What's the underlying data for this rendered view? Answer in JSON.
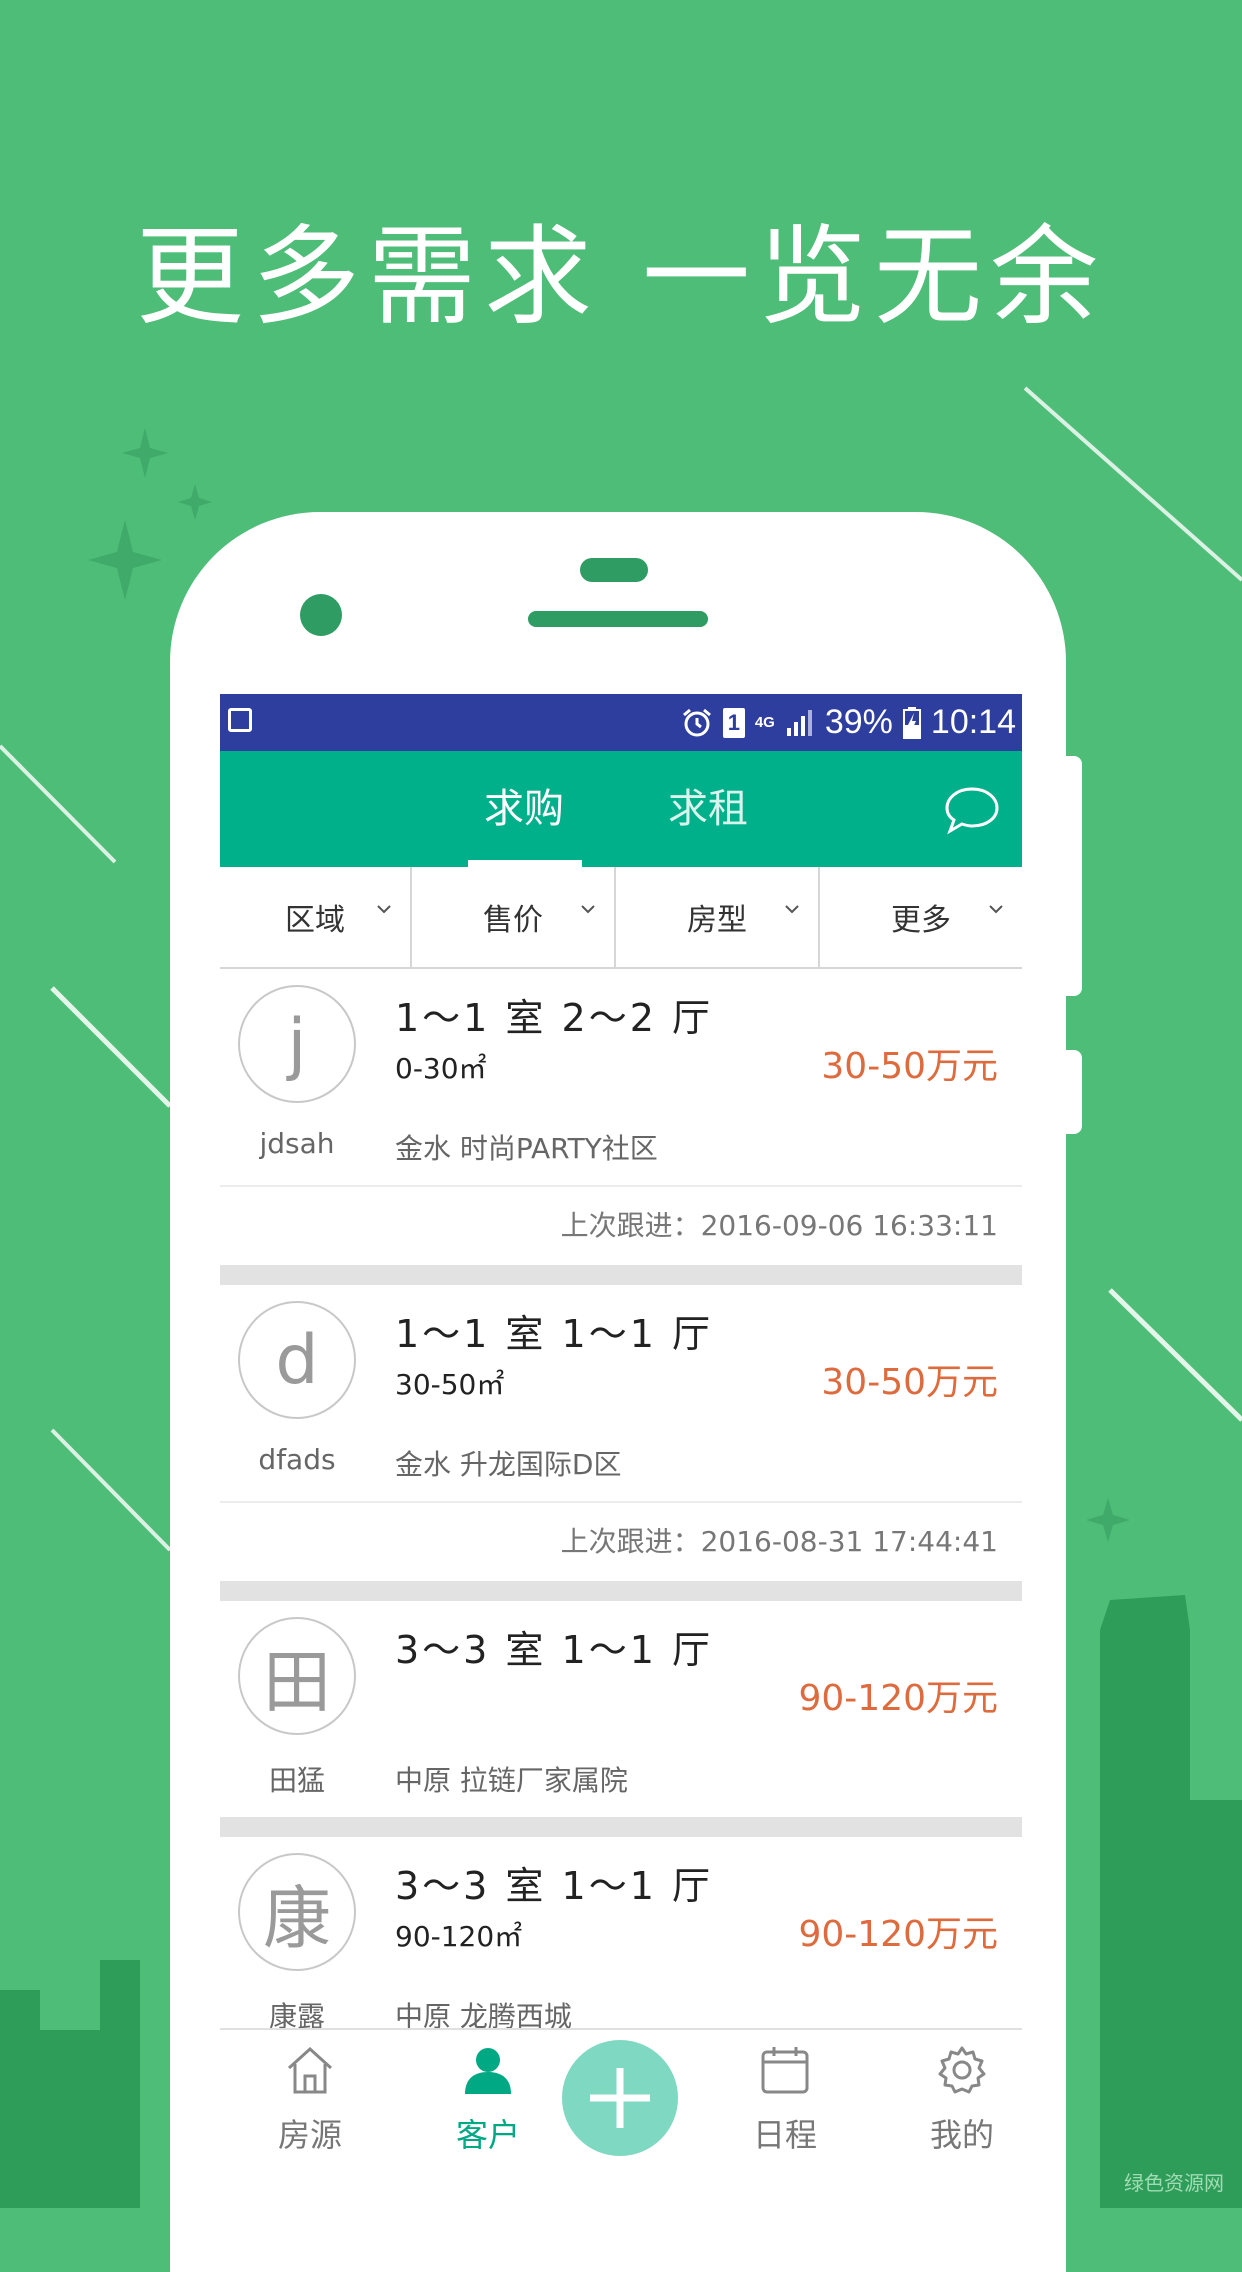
{
  "promo": {
    "title": "更多需求 一览无余"
  },
  "colors": {
    "background": "#4dbd78",
    "statusbar": "#2d3e9e",
    "appbar": "#00b08b",
    "price": "#dd6b3d",
    "accent": "#00a884"
  },
  "statusbar": {
    "sim": "1",
    "network": "4G",
    "battery": "39%",
    "time": "10:14",
    "icons": [
      "image-icon",
      "alarm-icon",
      "sim-icon",
      "network-icon",
      "signal-icon",
      "battery-icon"
    ]
  },
  "appbar": {
    "tabs": [
      {
        "label": "求购",
        "active": true
      },
      {
        "label": "求租",
        "active": false
      }
    ],
    "chat_icon": "chat-bubble-icon"
  },
  "filters": [
    {
      "label": "区域"
    },
    {
      "label": "售价"
    },
    {
      "label": "房型"
    },
    {
      "label": "更多"
    }
  ],
  "listings": [
    {
      "avatar": "j",
      "name": "jdsah",
      "room": "1～1 室 2～2 厅",
      "area": "0-30㎡",
      "price": "30-50万元",
      "district": "金水 时尚PARTY社区",
      "last_follow": "上次跟进：2016-09-06 16:33:11"
    },
    {
      "avatar": "d",
      "name": "dfads",
      "room": "1～1 室 1～1 厅",
      "area": "30-50㎡",
      "price": "30-50万元",
      "district": "金水 升龙国际D区",
      "last_follow": "上次跟进：2016-08-31 17:44:41"
    },
    {
      "avatar": "田",
      "name": "田猛",
      "room": "3～3 室 1～1 厅",
      "area": "",
      "price": "90-120万元",
      "district": "中原 拉链厂家属院",
      "last_follow": ""
    },
    {
      "avatar": "康",
      "name": "康露",
      "room": "3～3 室 1～1 厅",
      "area": "90-120㎡",
      "price": "90-120万元",
      "district": "中原 龙腾西城",
      "last_follow": ""
    }
  ],
  "bottomnav": {
    "items": [
      {
        "label": "房源",
        "icon": "home-icon"
      },
      {
        "label": "客户",
        "icon": "person-icon",
        "active": true
      },
      {
        "label": "日程",
        "icon": "calendar-icon"
      },
      {
        "label": "我的",
        "icon": "gear-icon"
      }
    ],
    "fab_icon": "plus-icon"
  },
  "watermark": "绿色资源网"
}
